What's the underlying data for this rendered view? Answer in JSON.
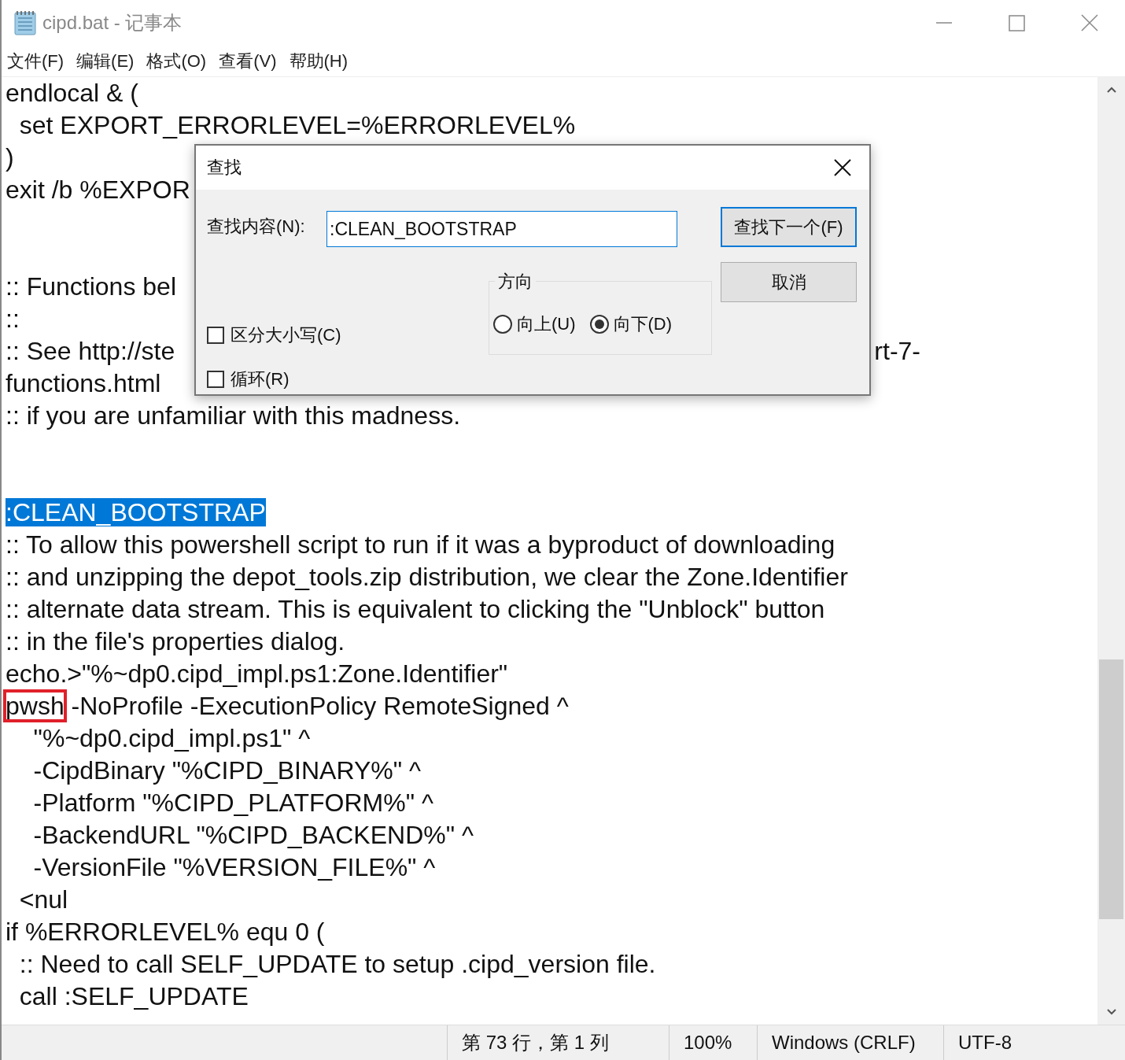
{
  "window": {
    "title": "cipd.bat - 记事本"
  },
  "menu": [
    "文件(F)",
    "编辑(E)",
    "格式(O)",
    "查看(V)",
    "帮助(H)"
  ],
  "editor": {
    "lines": [
      {
        "kind": "text",
        "text": "endlocal & ("
      },
      {
        "kind": "text",
        "text": "  set EXPORT_ERRORLEVEL=%ERRORLEVEL%"
      },
      {
        "kind": "text",
        "text": ")"
      },
      {
        "kind": "text",
        "text": "exit /b %EXPOR"
      },
      {
        "kind": "blank"
      },
      {
        "kind": "blank"
      },
      {
        "kind": "text",
        "text": ":: Functions bel"
      },
      {
        "kind": "text",
        "text": "::"
      },
      {
        "kind": "split",
        "text": ":: See http://ste",
        "right": "rt-7-"
      },
      {
        "kind": "text",
        "text": "functions.html"
      },
      {
        "kind": "text",
        "text": ":: if you are unfamiliar with this madness."
      },
      {
        "kind": "blank"
      },
      {
        "kind": "blank"
      },
      {
        "kind": "selection",
        "text": ":CLEAN_BOOTSTRAP"
      },
      {
        "kind": "text",
        "text": ":: To allow this powershell script to run if it was a byproduct of downloading"
      },
      {
        "kind": "text",
        "text": ":: and unzipping the depot_tools.zip distribution, we clear the Zone.Identifier"
      },
      {
        "kind": "text",
        "text": ":: alternate data stream. This is equivalent to clicking the \"Unblock\" button"
      },
      {
        "kind": "text",
        "text": ":: in the file's properties dialog."
      },
      {
        "kind": "text",
        "text": "echo.>\"%~dp0.cipd_impl.ps1:Zone.Identifier\""
      },
      {
        "kind": "boxed",
        "boxed": "pwsh",
        "text": " -NoProfile -ExecutionPolicy RemoteSigned ^"
      },
      {
        "kind": "text",
        "text": "    \"%~dp0.cipd_impl.ps1\" ^"
      },
      {
        "kind": "text",
        "text": "    -CipdBinary \"%CIPD_BINARY%\" ^"
      },
      {
        "kind": "text",
        "text": "    -Platform \"%CIPD_PLATFORM%\" ^"
      },
      {
        "kind": "text",
        "text": "    -BackendURL \"%CIPD_BACKEND%\" ^"
      },
      {
        "kind": "text",
        "text": "    -VersionFile \"%VERSION_FILE%\" ^"
      },
      {
        "kind": "text",
        "text": "  <nul"
      },
      {
        "kind": "text",
        "text": "if %ERRORLEVEL% equ 0 ("
      },
      {
        "kind": "text",
        "text": "  :: Need to call SELF_UPDATE to setup .cipd_version file."
      },
      {
        "kind": "text",
        "text": "  call :SELF_UPDATE"
      }
    ]
  },
  "find_dialog": {
    "title": "查找",
    "search_label": "查找内容(N):",
    "search_value": ":CLEAN_BOOTSTRAP",
    "options": [
      {
        "label": "区分大小写(C)",
        "checked": false
      },
      {
        "label": "循环(R)",
        "checked": false
      }
    ],
    "direction": {
      "label": "方向",
      "choices": [
        {
          "label": "向上(U)",
          "selected": false
        },
        {
          "label": "向下(D)",
          "selected": true
        }
      ]
    },
    "buttons": [
      {
        "label": "查找下一个(F)",
        "default": true
      },
      {
        "label": "取消",
        "default": false
      }
    ]
  },
  "status_bar": [
    "第 73 行，第 1 列",
    "100%",
    "Windows (CRLF)",
    "UTF-8"
  ]
}
